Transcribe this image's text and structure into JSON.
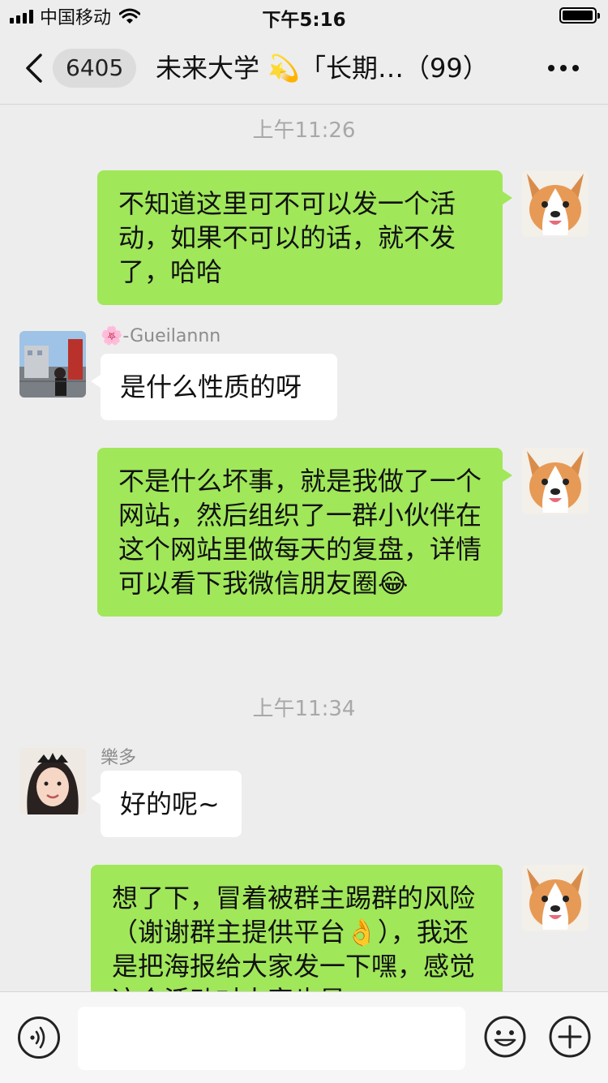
{
  "status_bar": {
    "carrier": "中国移动",
    "time": "下午5:16"
  },
  "nav": {
    "back_count": "6405",
    "title": "未来大学 💫「长期…（99）"
  },
  "messages": [
    {
      "type": "time",
      "text": "上午11:26"
    },
    {
      "type": "outgoing",
      "text": "不知道这里可不可以发一个活动，如果不可以的话，就不发了，哈哈"
    },
    {
      "type": "incoming",
      "sender": "🌸-Gueilannn",
      "text": "是什么性质的呀"
    },
    {
      "type": "outgoing",
      "text": "不是什么坏事，就是我做了一个网站，然后组织了一群小伙伴在这个网站里做每天的复盘，详情可以看下我微信朋友圈😂"
    },
    {
      "type": "time",
      "text": "上午11:34"
    },
    {
      "type": "incoming",
      "sender": "樂多",
      "text": "好的呢~"
    },
    {
      "type": "outgoing",
      "text": "想了下，冒着被群主踢群的风险（谢谢群主提供平台👌），我还是把海报给大家发一下嘿，感觉这个活动对大家也是"
    }
  ],
  "input": {
    "placeholder": ""
  },
  "colors": {
    "background": "#ededed",
    "outgoing_bubble": "#a0e75a",
    "incoming_bubble": "#ffffff",
    "timestamp": "#a8a8a8"
  }
}
